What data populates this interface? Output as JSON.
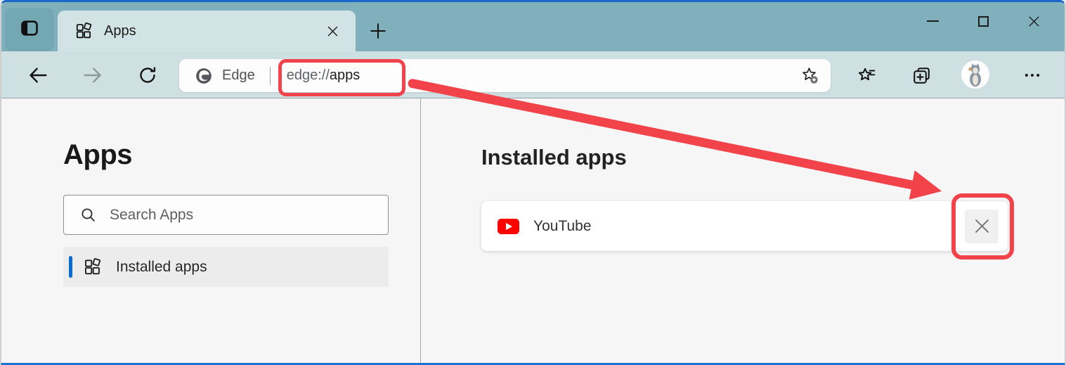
{
  "window": {
    "controls": [
      {
        "name": "minimize"
      },
      {
        "name": "maximize"
      },
      {
        "name": "close"
      }
    ]
  },
  "tab_bar": {
    "active_tab": {
      "label": "Apps"
    }
  },
  "toolbar": {
    "engine_label": "Edge",
    "url": {
      "scheme": "edge://",
      "path": "apps",
      "full": "edge://apps"
    }
  },
  "sidebar": {
    "title": "Apps",
    "search": {
      "placeholder": "Search Apps"
    },
    "items": [
      {
        "label": "Installed apps",
        "selected": true
      }
    ]
  },
  "main": {
    "heading": "Installed apps",
    "apps": [
      {
        "name": "YouTube"
      }
    ]
  },
  "annotations": {
    "color": "#f2434b",
    "highlights": [
      "url-in-address-bar",
      "remove-app-button"
    ],
    "arrow": {
      "from": "address-bar-url",
      "to": "remove-app-button"
    }
  },
  "colors": {
    "tab_strip_bg": "#7fb0bb",
    "active_tab_bg": "#d2e3e5",
    "toolbar_bg": "#cfe0e3",
    "content_bg": "#f6f6f6",
    "selected_item_bg": "#ececec",
    "selection_accent": "#0b6ecf",
    "window_border_accent": "#1b66c9",
    "youtube_red": "#fe0000",
    "annotation_red": "#f2434b"
  }
}
